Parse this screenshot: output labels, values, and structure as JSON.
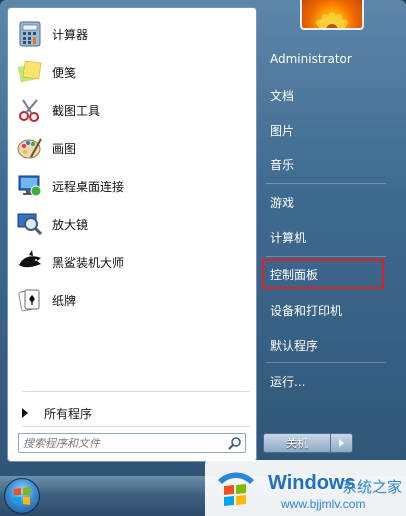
{
  "start_menu": {
    "programs": [
      {
        "label": "计算器",
        "icon": "calculator-icon"
      },
      {
        "label": "便笺",
        "icon": "sticky-notes-icon"
      },
      {
        "label": "截图工具",
        "icon": "snipping-tool-icon"
      },
      {
        "label": "画图",
        "icon": "paint-icon"
      },
      {
        "label": "远程桌面连接",
        "icon": "remote-desktop-icon"
      },
      {
        "label": "放大镜",
        "icon": "magnifier-icon"
      },
      {
        "label": "黑鲨装机大师",
        "icon": "black-shark-icon"
      },
      {
        "label": "纸牌",
        "icon": "solitaire-icon"
      }
    ],
    "all_programs_label": "所有程序",
    "search_placeholder": "搜索程序和文件",
    "right_items": [
      {
        "label": "Administrator"
      },
      {
        "label": "文档"
      },
      {
        "label": "图片"
      },
      {
        "label": "音乐"
      },
      {
        "label": "游戏"
      },
      {
        "label": "计算机"
      },
      {
        "label": "控制面板"
      },
      {
        "label": "设备和打印机"
      },
      {
        "label": "默认程序"
      },
      {
        "label": "运行..."
      }
    ],
    "highlighted_item": "控制面板",
    "shutdown_label": "关机"
  },
  "watermark": {
    "title": "Windows",
    "subtitle": "系统之家",
    "url": "www.bjjmlv.com"
  },
  "colors": {
    "highlight_border": "#e02020",
    "frame": "#3f6a90",
    "watermark_blue": "#1f6fc2"
  }
}
